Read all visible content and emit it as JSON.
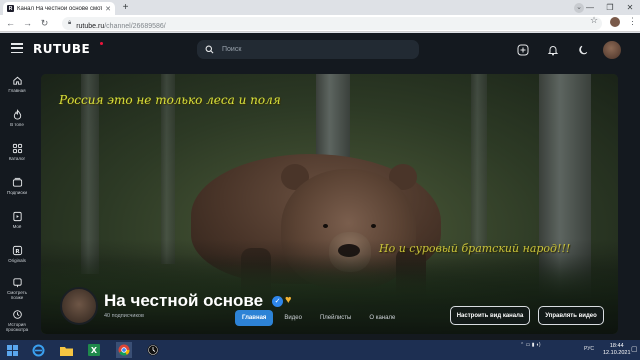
{
  "browser": {
    "tab_title": "Канал На честной основе смот",
    "tab_favicon": "R",
    "url_host": "rutube.ru",
    "url_path": "/channel/26689586/",
    "new_tab_symbol": "+",
    "tab_close_symbol": "✕"
  },
  "header": {
    "logo": "RUTUBE",
    "search_placeholder": "Поиск"
  },
  "sidebar": {
    "items": [
      {
        "label": "Главная",
        "icon": "home-icon"
      },
      {
        "label": "В топе",
        "icon": "fire-icon"
      },
      {
        "label": "Каталог",
        "icon": "catalog-icon"
      },
      {
        "label": "Подписки",
        "icon": "subscriptions-icon"
      },
      {
        "label": "Моё",
        "icon": "my-icon"
      },
      {
        "label": "Originals",
        "icon": "originals-icon"
      },
      {
        "label": "Смотреть позже",
        "icon": "watch-later-icon"
      },
      {
        "label": "История просмотра",
        "icon": "history-icon"
      }
    ]
  },
  "banner": {
    "caption_top": "Россия это не только леса и поля",
    "caption_bottom": "Но и суровый братский народ!!!"
  },
  "channel": {
    "name": "На честной основе",
    "subscribers": "40 подписчиков",
    "btn_customize": "Настроить вид канала",
    "btn_manage": "Управлять видео",
    "tabs": [
      "Главная",
      "Видео",
      "Плейлисты",
      "О канале"
    ],
    "active_tab": "Главная"
  },
  "taskbar": {
    "lang": "РУС",
    "time": "18:44",
    "date": "12.10.2021"
  },
  "colors": {
    "app_bg": "#14191f",
    "accent": "#2d83d6",
    "logo_dot": "#ed143b",
    "caption": "#d8e03a"
  }
}
